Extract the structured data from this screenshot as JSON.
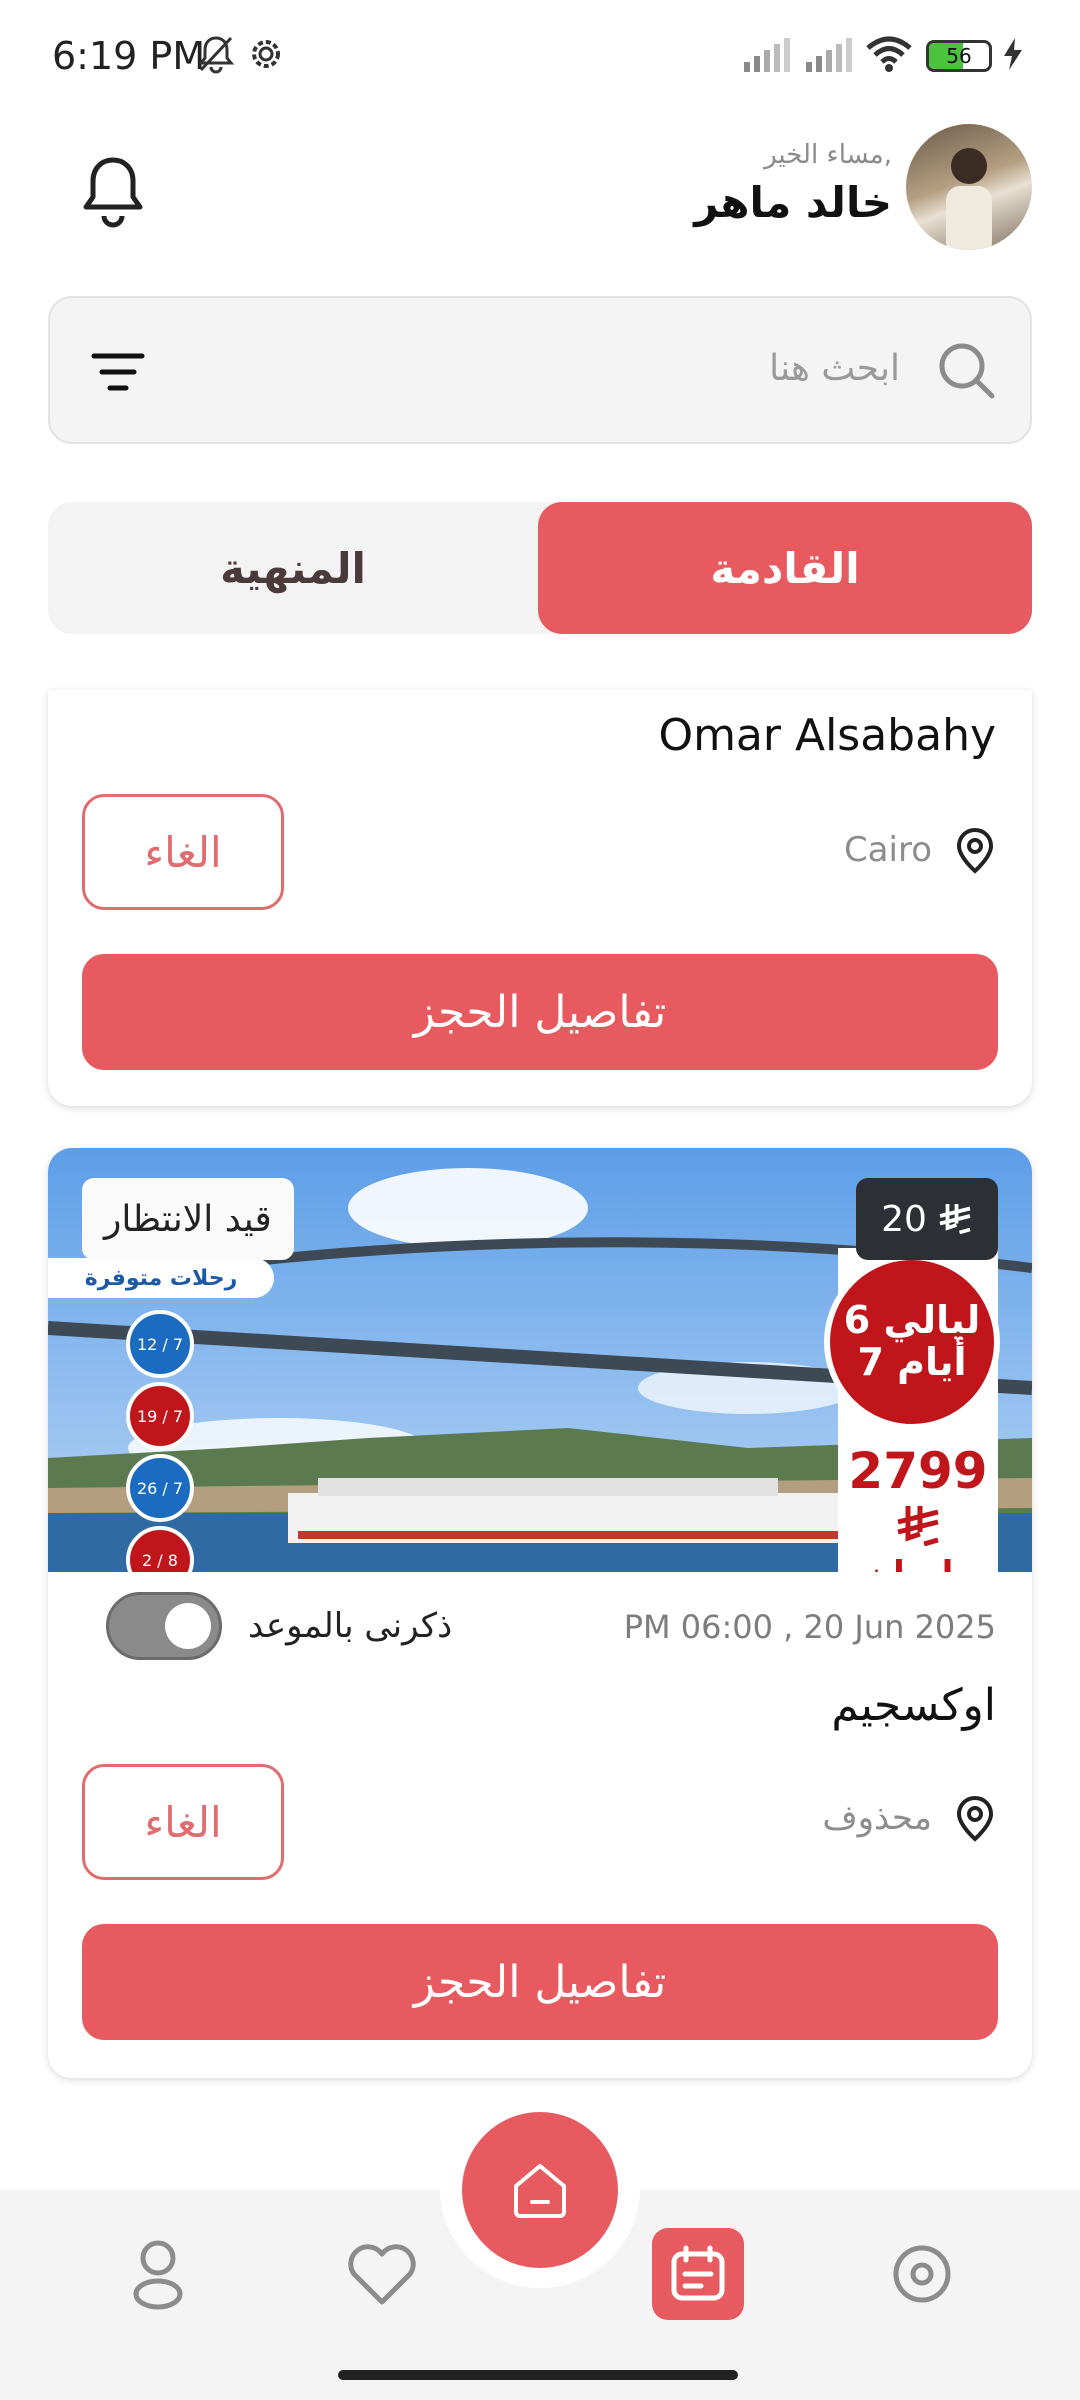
{
  "status_bar": {
    "time": "6:19 PM",
    "battery": "56",
    "icons": [
      "bell-off-icon",
      "gear-icon",
      "signal-icon",
      "signal-icon",
      "wifi-icon",
      "battery-icon",
      "charging-icon"
    ]
  },
  "header": {
    "greeting": "مساء الخير,",
    "username": "خالد ماهر",
    "avatar_icon": "avatar-photo",
    "bell_icon": "bell-icon"
  },
  "search": {
    "placeholder": "ابحث هنا",
    "search_icon": "search-icon",
    "filter_icon": "filter-icon"
  },
  "tabs": [
    {
      "label": "القادمة",
      "active": true
    },
    {
      "label": "المنهية",
      "active": false
    }
  ],
  "cards": [
    {
      "title": "Omar Alsabahy",
      "location": "Cairo",
      "cancel_label": "الغاء",
      "details_label": "تفاصيل الحجز"
    },
    {
      "status_label": "قيد الانتظار",
      "price": "20",
      "image": {
        "tag": "رحلات متوفرة",
        "nights": "6 ليالي",
        "days": "7 أيام",
        "promo_price": "2799",
        "promo_more": "طيران",
        "dates": [
          "12 / 7",
          "19 / 7",
          "26 / 7",
          "2 / 8"
        ]
      },
      "date_time": "PM 06:00 , 20 Jun 2025",
      "reminder_label": "ذكرنى بالموعد",
      "reminder_on": false,
      "title": "اوكسجيم",
      "location": "محذوف",
      "cancel_label": "الغاء",
      "details_label": "تفاصيل الحجز"
    }
  ],
  "bottom_nav": {
    "items": [
      "profile-icon",
      "heart-icon",
      "home-icon",
      "bookings-icon",
      "location-icon"
    ],
    "active": "bookings-icon"
  },
  "colors": {
    "accent": "#e75b60",
    "muted_text": "#8c8c8c",
    "tab_bg": "#f3f3f3"
  }
}
